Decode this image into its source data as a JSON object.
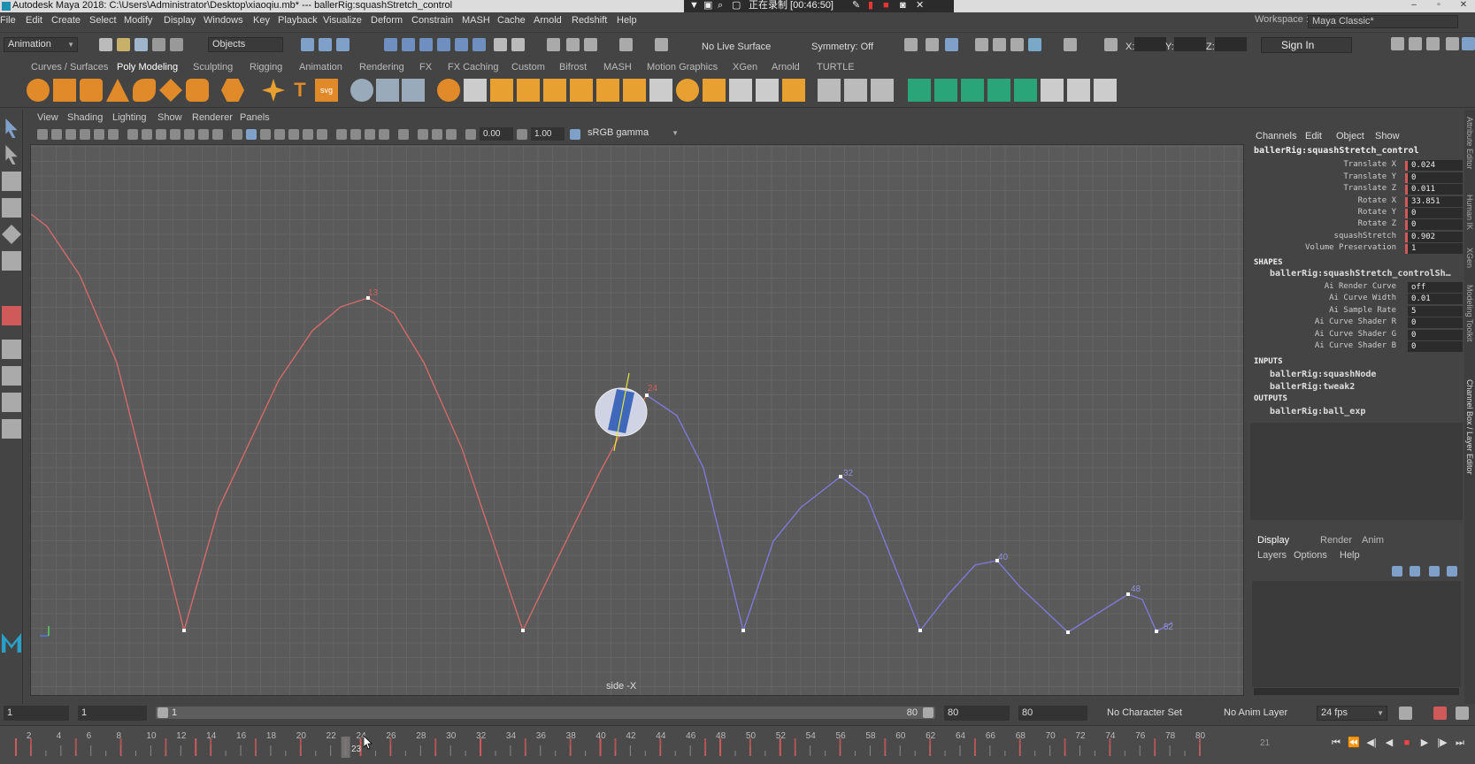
{
  "window": {
    "title": "Autodesk Maya 2018: C:\\Users\\Administrator\\Desktop\\xiaoqiu.mb*   ---   ballerRig:squashStretch_control",
    "recording_label": "正在录制 [00:46:50]"
  },
  "menubar": {
    "items": [
      "File",
      "Edit",
      "Create",
      "Select",
      "Modify",
      "Display",
      "Windows",
      "Key",
      "Playback",
      "Visualize",
      "Deform",
      "Constrain",
      "MASH",
      "Cache",
      "Arnold",
      "Redshift",
      "Help"
    ],
    "workspace_label": "Workspace :",
    "workspace_value": "Maya Classic*"
  },
  "statusline": {
    "mode": "Animation",
    "selection_mode": "Objects",
    "live_surface": "No Live Surface",
    "symmetry": "Symmetry: Off",
    "x_label": "X:",
    "y_label": "Y:",
    "z_label": "Z:",
    "sign_in": "Sign In"
  },
  "shelf": {
    "tabs": [
      "Curves / Surfaces",
      "Poly Modeling",
      "Sculpting",
      "Rigging",
      "Animation",
      "Rendering",
      "FX",
      "FX Caching",
      "Custom",
      "Bifrost",
      "MASH",
      "Motion Graphics",
      "XGen",
      "Arnold",
      "TURTLE"
    ],
    "active_tab": "Poly Modeling"
  },
  "viewport": {
    "menu": [
      "View",
      "Shading",
      "Lighting",
      "Show",
      "Renderer",
      "Panels"
    ],
    "exposure": "0.00",
    "gamma": "1.00",
    "color_space": "sRGB gamma",
    "camera": "side -X",
    "keyframe_labels": [
      "13",
      "24",
      "32",
      "40",
      "48",
      "52"
    ]
  },
  "channel_box": {
    "menu": [
      "Channels",
      "Edit",
      "Object",
      "Show"
    ],
    "node": "ballerRig:squashStretch_control",
    "attributes": [
      {
        "label": "Translate X",
        "value": "0.024"
      },
      {
        "label": "Translate Y",
        "value": "0"
      },
      {
        "label": "Translate Z",
        "value": "0.011"
      },
      {
        "label": "Rotate X",
        "value": "33.851"
      },
      {
        "label": "Rotate Y",
        "value": "0"
      },
      {
        "label": "Rotate Z",
        "value": "0"
      },
      {
        "label": "squashStretch",
        "value": "0.902"
      },
      {
        "label": "Volume Preservation",
        "value": "1"
      }
    ],
    "shapes_header": "SHAPES",
    "shape_node": "ballerRig:squashStretch_controlSh…",
    "shape_attributes": [
      {
        "label": "Ai Render Curve",
        "value": "off"
      },
      {
        "label": "Ai Curve Width",
        "value": "0.01"
      },
      {
        "label": "Ai Sample Rate",
        "value": "5"
      },
      {
        "label": "Ai Curve Shader R",
        "value": "0"
      },
      {
        "label": "Ai Curve Shader G",
        "value": "0"
      },
      {
        "label": "Ai Curve Shader B",
        "value": "0"
      }
    ],
    "inputs_header": "INPUTS",
    "inputs": [
      "ballerRig:squashNode",
      "ballerRig:tweak2"
    ],
    "outputs_header": "OUTPUTS",
    "outputs": [
      "ballerRig:ball_exp"
    ]
  },
  "side_strip": [
    "Attribute Editor",
    "Human IK",
    "XGen",
    "Modeling Toolkit",
    "Channel Box / Layer Editor"
  ],
  "layer_editor": {
    "tabs": [
      "Display",
      "Render",
      "Anim"
    ],
    "active_tab": "Display",
    "menu": [
      "Layers",
      "Options",
      "Help"
    ]
  },
  "range_slider": {
    "start_field": "1",
    "current_start": "1",
    "range_start_label": "1",
    "range_end_label": "80",
    "end_field": "80",
    "anim_end": "80",
    "character_set": "No Character Set",
    "anim_layer": "No Anim Layer",
    "fps": "24 fps"
  },
  "timeline": {
    "ticks": [
      "2",
      "4",
      "6",
      "8",
      "10",
      "12",
      "14",
      "16",
      "18",
      "20",
      "22",
      "24",
      "26",
      "28",
      "30",
      "32",
      "34",
      "36",
      "38",
      "40",
      "42",
      "44",
      "46",
      "48",
      "50",
      "52",
      "54",
      "56",
      "58",
      "60",
      "62",
      "64",
      "66",
      "68",
      "70",
      "72",
      "74",
      "76",
      "78",
      "80"
    ],
    "current_frame": "23",
    "right_readout": "21"
  },
  "colors": {
    "path_before": "#d46a6a",
    "path_after": "#7f78d8",
    "accent": "#d05a5a"
  }
}
